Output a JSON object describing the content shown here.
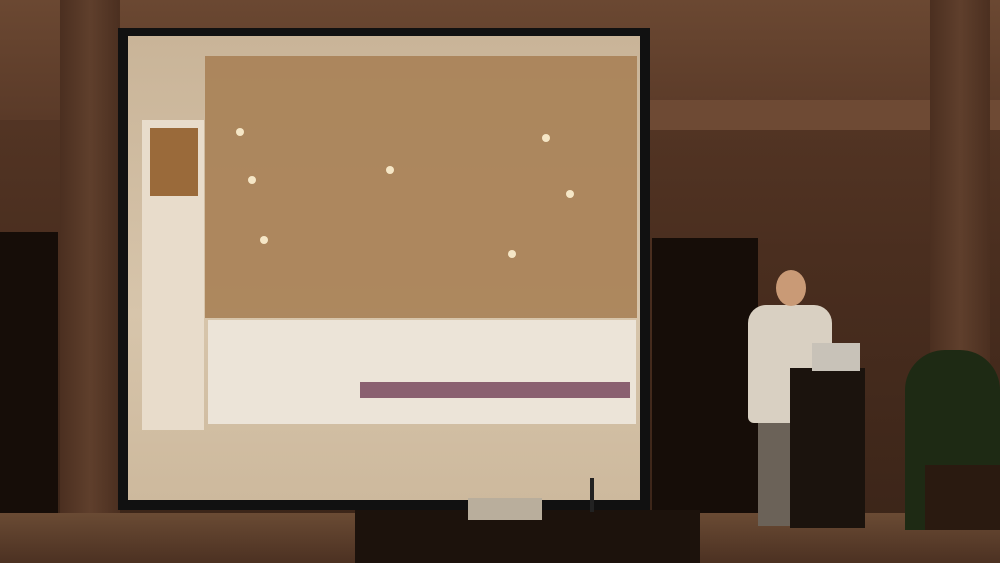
{
  "scene": {
    "description_icon": "photo-icon",
    "subjects": [
      "projection-screen",
      "speaker",
      "lectern",
      "projector",
      "plant"
    ],
    "colors": {
      "wall": "#5a3a28",
      "screen": "#d7c5ab",
      "projected-app": "#a98258"
    }
  }
}
